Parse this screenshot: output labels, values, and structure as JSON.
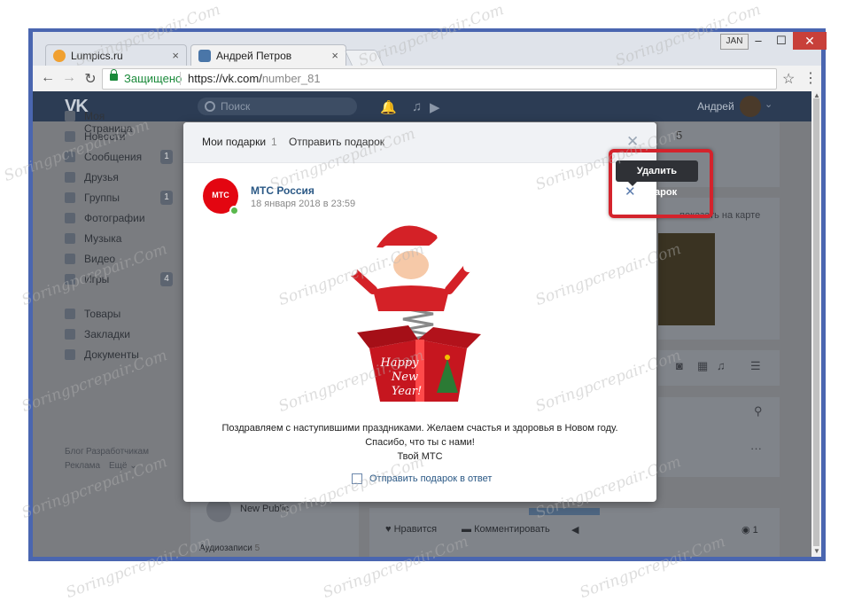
{
  "browser": {
    "tabs": [
      {
        "label": "Lumpics.ru",
        "close": "×"
      },
      {
        "label": "Андрей Петров",
        "close": "×"
      }
    ],
    "user_chip": "JAN",
    "window_controls": {
      "minimize": "–",
      "maximize": "☐",
      "close": "✕"
    },
    "nav": {
      "back": "←",
      "forward": "→",
      "reload": "↻"
    },
    "address": {
      "secure_label": "Защищено",
      "url_main": "https://vk.com/",
      "url_path": "number_81"
    },
    "star": "☆",
    "menu": "⋮"
  },
  "vk": {
    "header": {
      "logo": "VK",
      "search_placeholder": "Поиск",
      "user_name": "Андрей"
    },
    "sidebar": [
      {
        "label": "Моя Страница",
        "badge": ""
      },
      {
        "label": "Новости",
        "badge": ""
      },
      {
        "label": "Сообщения",
        "badge": "1"
      },
      {
        "label": "Друзья",
        "badge": ""
      },
      {
        "label": "Группы",
        "badge": "1"
      },
      {
        "label": "Фотографии",
        "badge": ""
      },
      {
        "label": "Музыка",
        "badge": ""
      },
      {
        "label": "Видео",
        "badge": ""
      },
      {
        "label": "Игры",
        "badge": "4"
      },
      {
        "label": "Товары",
        "badge": ""
      },
      {
        "label": "Закладки",
        "badge": ""
      },
      {
        "label": "Документы",
        "badge": ""
      }
    ],
    "footer_links": {
      "blog": "Блог",
      "developers": "Разработчикам",
      "ads": "Реклама",
      "more": "Ещё ⌄"
    },
    "background": {
      "show_on_map": "показать на карте",
      "count_number": "5",
      "new_public": "New Public",
      "audio_label": "Аудиозаписи",
      "audio_count": "5",
      "like_label": "Нравится",
      "comment_label": "Комментировать",
      "views_count": "1"
    },
    "gift_modal": {
      "title": "Мои подарки",
      "count": "1",
      "send_link": "Отправить подарок",
      "sender_name": "МТС Россия",
      "avatar_text": "МТС",
      "date": "18 января 2018 в 23:59",
      "delete_tooltip": "Удалить подарок",
      "message_lines": [
        "Поздравляем с наступившими праздниками. Желаем счастья и здоровья в Новом году.",
        "Спасибо, что ты с нами!",
        "Твой МТС"
      ],
      "reply_link": "Отправить подарок в ответ",
      "gift_box_text": [
        "Happy",
        "New",
        "Year!"
      ]
    }
  },
  "watermark": "Soringpcrepair.Com",
  "colors": {
    "vk_header": "#2c3c54",
    "link": "#2a5885",
    "highlight": "#d4232c",
    "chrome_border": "#4a66b0"
  }
}
